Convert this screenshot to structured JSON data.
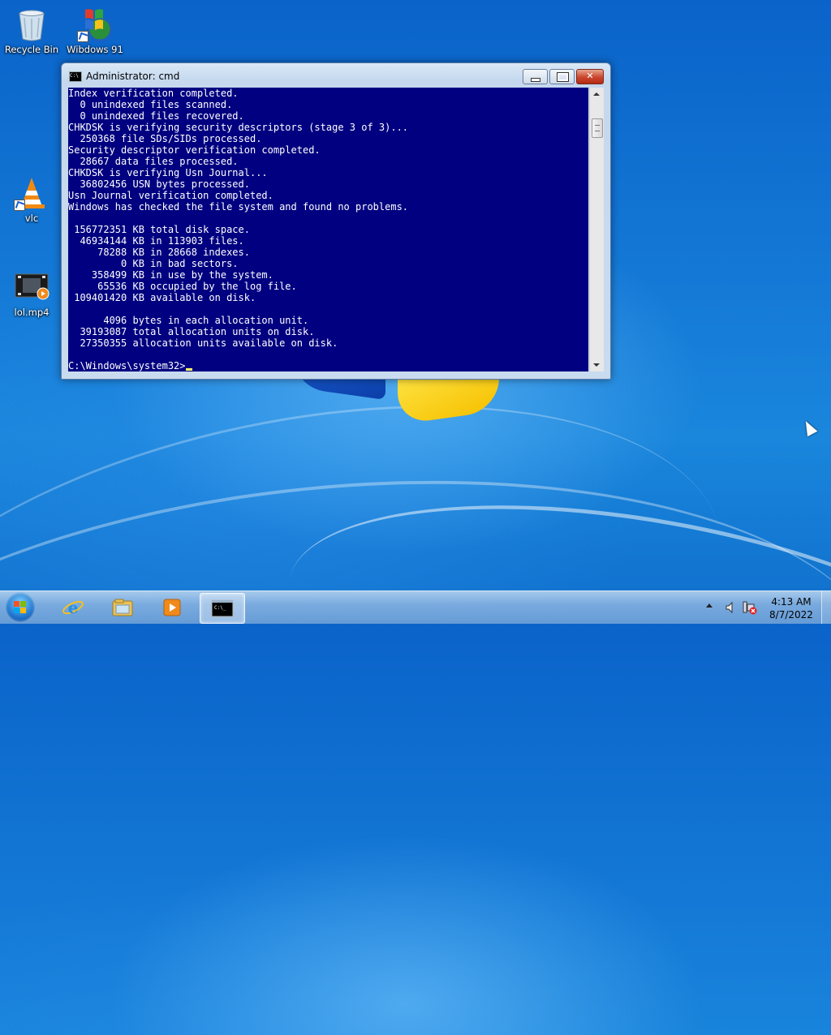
{
  "desktop": {
    "icons": [
      {
        "label": "Recycle Bin",
        "icon": "recycle-bin-icon"
      },
      {
        "label": "Wibdows 91",
        "icon": "windows-logo-icon"
      },
      {
        "label": "vlc",
        "icon": "vlc-cone-icon"
      },
      {
        "label": "lol.mp4",
        "icon": "video-file-icon"
      }
    ]
  },
  "window": {
    "title": "Administrator: cmd",
    "console_lines": [
      "Index verification completed.",
      "  0 unindexed files scanned.",
      "  0 unindexed files recovered.",
      "CHKDSK is verifying security descriptors (stage 3 of 3)...",
      "  250368 file SDs/SIDs processed.",
      "Security descriptor verification completed.",
      "  28667 data files processed.",
      "CHKDSK is verifying Usn Journal...",
      "  36802456 USN bytes processed.",
      "Usn Journal verification completed.",
      "Windows has checked the file system and found no problems.",
      "",
      " 156772351 KB total disk space.",
      "  46934144 KB in 113903 files.",
      "     78288 KB in 28668 indexes.",
      "         0 KB in bad sectors.",
      "    358499 KB in use by the system.",
      "     65536 KB occupied by the log file.",
      " 109401420 KB available on disk.",
      "",
      "      4096 bytes in each allocation unit.",
      "  39193087 total allocation units on disk.",
      "  27350355 allocation units available on disk.",
      "",
      "C:\\Windows\\system32>"
    ],
    "console_bg": "#000080",
    "console_fg": "#ffffff"
  },
  "taskbar": {
    "items": [
      {
        "icon": "internet-explorer-icon"
      },
      {
        "icon": "file-explorer-icon"
      },
      {
        "icon": "media-player-icon"
      },
      {
        "icon": "cmd-icon",
        "active": true
      }
    ],
    "tray_icons": [
      "show-hidden-icons-chevron",
      "volume-icon",
      "network-error-icon"
    ],
    "clock_time": "4:13 AM",
    "clock_date": "8/7/2022"
  }
}
